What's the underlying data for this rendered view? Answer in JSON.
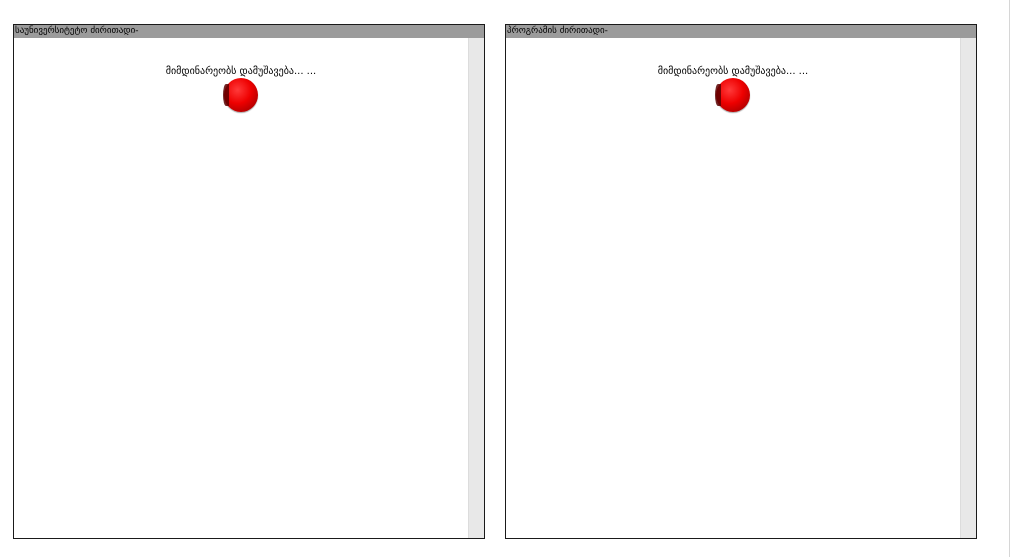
{
  "panels": {
    "left": {
      "title": "საუნივერსიტეტო ძირითადი-",
      "loading_text": "მიმდინარეობს დამუშავება... ..."
    },
    "right": {
      "title": "პროგრამის ძირითადი-",
      "loading_text": "მიმდინარეობს დამუშავება... ..."
    }
  },
  "colors": {
    "header_bg": "#9b9b9b",
    "spinner": "#ee0000",
    "scrollbar": "#e8e8e8"
  },
  "icons": {
    "spinner": "loading-spinner-icon"
  }
}
